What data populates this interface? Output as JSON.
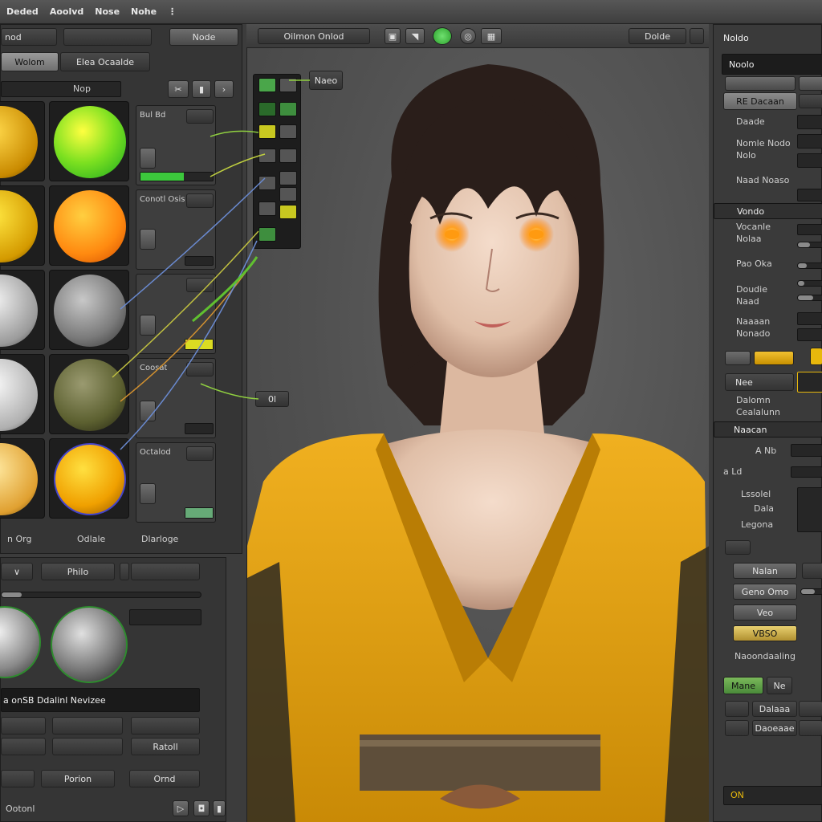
{
  "menubar": {
    "items": [
      "Deded",
      "Aoolvd",
      "Nose",
      "Nohe"
    ]
  },
  "left_panel": {
    "top_row": [
      "nod",
      "Node"
    ],
    "tabs": [
      "Wolom",
      "Elea Ocaalde"
    ],
    "toolbar_label": "Nop",
    "material_rows": [
      {
        "props_label": "Bul Bd",
        "swatch_color": "#22dd33"
      },
      {
        "props_label": "Conotl Osis",
        "swatch_color": "#6a6a6a"
      },
      {
        "props_label": "",
        "swatch_color": "#dcdc22"
      },
      {
        "props_label": "Coosat",
        "swatch_color": "#cccc22"
      },
      {
        "props_label": "Octalod",
        "swatch_color": "#66aa77"
      }
    ],
    "bottom_labels": [
      "n Org",
      "Odlale",
      "Dlarloge"
    ],
    "lower_tab": "Philo",
    "section_title": "a onSB Ddalinl Nevizee",
    "bottom_fields": [
      "Porion",
      "Ornd"
    ],
    "status": "Ootonl",
    "mid_field": "Ratoll"
  },
  "viewport": {
    "toolbar_label": "Oilmon Onlod",
    "right_label": "Dolde",
    "node_popup_label": "Naeo",
    "node_badge": "0l",
    "accent_color": "#e8a21d"
  },
  "right_panel": {
    "header": "Noldo",
    "field_label": "Noolo",
    "selected": "RE Dacaan",
    "rows": [
      "Daade",
      "Nomle Nodo Nolo",
      "Naad Noaso",
      "Vondo",
      "Vocanle Nolaa",
      "Pao Oka",
      "Doudie Naad",
      "Naaaan Nonado",
      "Nee",
      "Dalomn Cealalunn",
      "Naacan"
    ],
    "mini_labels": [
      "A Nb",
      "a Ld"
    ],
    "list_labels": [
      "Lssolel",
      "Dala",
      "Legona"
    ],
    "lower_buttons": [
      "Nalan",
      "Geno Omo",
      "Veo",
      "VBSO"
    ],
    "lower_label": "Naoondaaling",
    "tabs": [
      "Mane",
      "Ne"
    ],
    "list_rows": [
      "Dalaaa",
      "Daoeaae"
    ],
    "status_badge": "ON"
  },
  "colors": {
    "accent_yellow": "#e8b80c",
    "active_green": "#3cc83c",
    "panel_bg": "#353535"
  }
}
